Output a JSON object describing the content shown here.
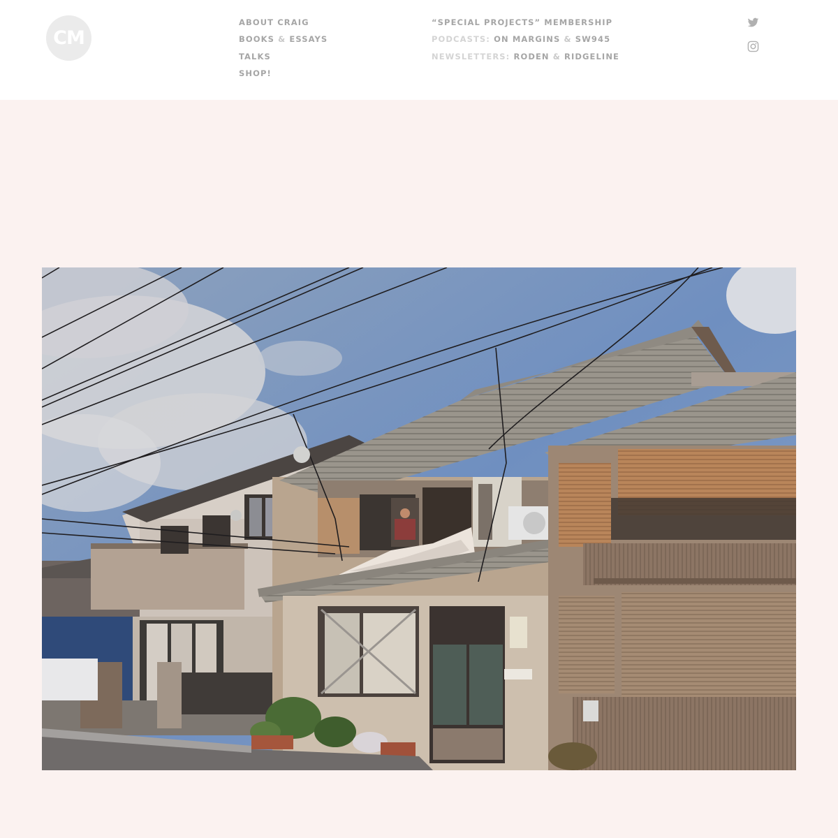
{
  "logo": {
    "text": "CM"
  },
  "nav": {
    "column1": [
      {
        "label": "About Craig"
      },
      {
        "label": "Books",
        "amp": "&",
        "label2": "Essays"
      },
      {
        "label": "Talks"
      },
      {
        "label": "Shop!"
      }
    ],
    "membership": "“Special Projects” Membership",
    "podcasts": {
      "prefix": "Podcasts:",
      "item1": "On Margins",
      "amp": "&",
      "item2": "SW945"
    },
    "newsletters": {
      "prefix": "Newsletters:",
      "item1": "Roden",
      "amp": "&",
      "item2": "Ridgeline"
    }
  },
  "social": {
    "icons": [
      "twitter-icon",
      "instagram-icon"
    ]
  },
  "colors": {
    "page_background": "#fbf2f0",
    "header_background": "#ffffff",
    "nav_text": "#a6a6a6"
  }
}
